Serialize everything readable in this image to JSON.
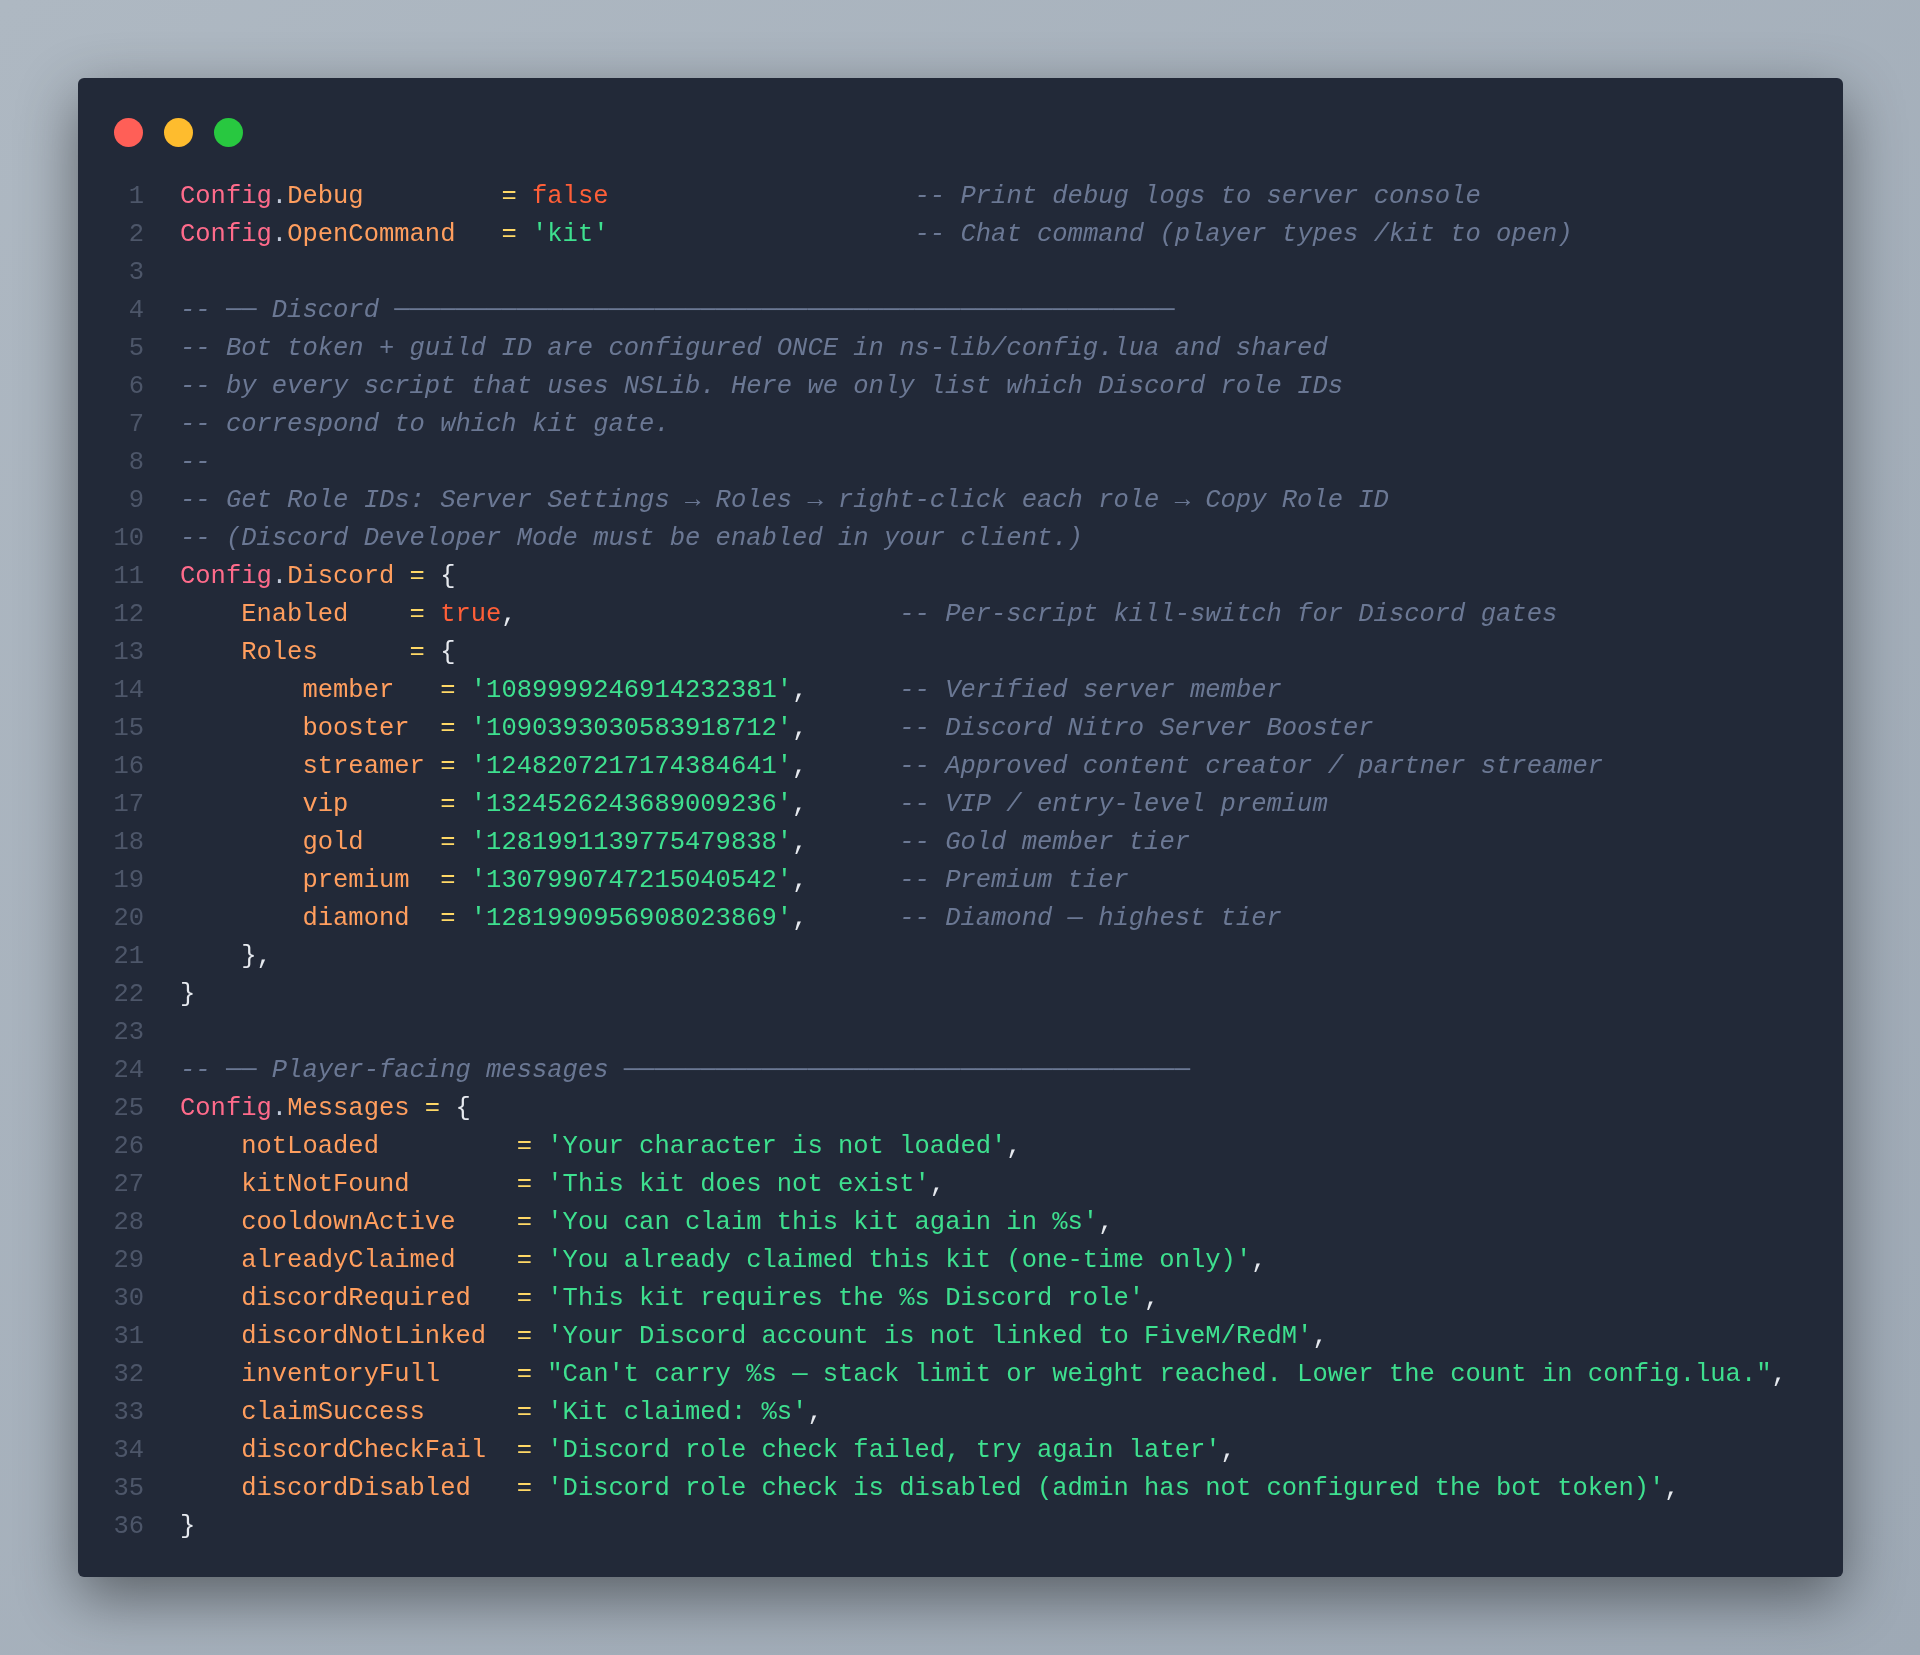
{
  "window_controls": [
    {
      "color": "#ff5f57"
    },
    {
      "color": "#febc2e"
    },
    {
      "color": "#28c840"
    }
  ],
  "lines": [
    {
      "number": "1",
      "tokens": [
        {
          "kind": "object",
          "text": "Config"
        },
        {
          "kind": "punct",
          "text": "."
        },
        {
          "kind": "key",
          "text": "Debug"
        },
        {
          "kind": "op",
          "text": "         ="
        },
        {
          "kind": "boolean",
          "text": " false"
        },
        {
          "kind": "comment",
          "text": "                    -- Print debug logs to server console"
        }
      ]
    },
    {
      "number": "2",
      "tokens": [
        {
          "kind": "object",
          "text": "Config"
        },
        {
          "kind": "punct",
          "text": "."
        },
        {
          "kind": "key",
          "text": "OpenCommand"
        },
        {
          "kind": "op",
          "text": "   ="
        },
        {
          "kind": "string",
          "text": " 'kit'"
        },
        {
          "kind": "comment",
          "text": "                    -- Chat command (player types /kit to open)"
        }
      ]
    },
    {
      "number": "3"
    },
    {
      "number": "4",
      "tokens": [
        {
          "kind": "comment",
          "text": "-- ── Discord ───────────────────────────────────────────────────"
        }
      ]
    },
    {
      "number": "5",
      "tokens": [
        {
          "kind": "comment",
          "text": "-- Bot token + guild ID are configured ONCE in ns-lib/config.lua and shared"
        }
      ]
    },
    {
      "number": "6",
      "tokens": [
        {
          "kind": "comment",
          "text": "-- by every script that uses NSLib. Here we only list which Discord role IDs"
        }
      ]
    },
    {
      "number": "7",
      "tokens": [
        {
          "kind": "comment",
          "text": "-- correspond to which kit gate."
        }
      ]
    },
    {
      "number": "8",
      "tokens": [
        {
          "kind": "comment",
          "text": "--"
        }
      ]
    },
    {
      "number": "9",
      "tokens": [
        {
          "kind": "comment",
          "text": "-- Get Role IDs: Server Settings → Roles → right-click each role → Copy Role ID"
        }
      ]
    },
    {
      "number": "10",
      "tokens": [
        {
          "kind": "comment",
          "text": "-- (Discord Developer Mode must be enabled in your client.)"
        }
      ]
    },
    {
      "number": "11",
      "tokens": [
        {
          "kind": "object",
          "text": "Config"
        },
        {
          "kind": "punct",
          "text": "."
        },
        {
          "kind": "key",
          "text": "Discord"
        },
        {
          "kind": "op",
          "text": " ="
        },
        {
          "kind": "plain",
          "text": " {"
        }
      ]
    },
    {
      "number": "12",
      "tokens": [
        {
          "kind": "key",
          "text": "    Enabled"
        },
        {
          "kind": "op",
          "text": "    ="
        },
        {
          "kind": "boolean",
          "text": " true"
        },
        {
          "kind": "plain",
          "text": ","
        },
        {
          "kind": "comment",
          "text": "                         -- Per-script kill-switch for Discord gates"
        }
      ]
    },
    {
      "number": "13",
      "tokens": [
        {
          "kind": "key",
          "text": "    Roles"
        },
        {
          "kind": "op",
          "text": "      ="
        },
        {
          "kind": "plain",
          "text": " {"
        }
      ]
    },
    {
      "number": "14",
      "tokens": [
        {
          "kind": "key",
          "text": "        member"
        },
        {
          "kind": "op",
          "text": "   ="
        },
        {
          "kind": "string",
          "text": " '1089999246914232381'"
        },
        {
          "kind": "plain",
          "text": ","
        },
        {
          "kind": "comment",
          "text": "      -- Verified server member"
        }
      ]
    },
    {
      "number": "15",
      "tokens": [
        {
          "kind": "key",
          "text": "        booster"
        },
        {
          "kind": "op",
          "text": "  ="
        },
        {
          "kind": "string",
          "text": " '1090393030583918712'"
        },
        {
          "kind": "plain",
          "text": ","
        },
        {
          "kind": "comment",
          "text": "      -- Discord Nitro Server Booster"
        }
      ]
    },
    {
      "number": "16",
      "tokens": [
        {
          "kind": "key",
          "text": "        streamer"
        },
        {
          "kind": "op",
          "text": " ="
        },
        {
          "kind": "string",
          "text": " '1248207217174384641'"
        },
        {
          "kind": "plain",
          "text": ","
        },
        {
          "kind": "comment",
          "text": "      -- Approved content creator / partner streamer"
        }
      ]
    },
    {
      "number": "17",
      "tokens": [
        {
          "kind": "key",
          "text": "        vip"
        },
        {
          "kind": "op",
          "text": "      ="
        },
        {
          "kind": "string",
          "text": " '1324526243689009236'"
        },
        {
          "kind": "plain",
          "text": ","
        },
        {
          "kind": "comment",
          "text": "      -- VIP / entry-level premium"
        }
      ]
    },
    {
      "number": "18",
      "tokens": [
        {
          "kind": "key",
          "text": "        gold"
        },
        {
          "kind": "op",
          "text": "     ="
        },
        {
          "kind": "string",
          "text": " '1281991139775479838'"
        },
        {
          "kind": "plain",
          "text": ","
        },
        {
          "kind": "comment",
          "text": "      -- Gold member tier"
        }
      ]
    },
    {
      "number": "19",
      "tokens": [
        {
          "kind": "key",
          "text": "        premium"
        },
        {
          "kind": "op",
          "text": "  ="
        },
        {
          "kind": "string",
          "text": " '1307990747215040542'"
        },
        {
          "kind": "plain",
          "text": ","
        },
        {
          "kind": "comment",
          "text": "      -- Premium tier"
        }
      ]
    },
    {
      "number": "20",
      "tokens": [
        {
          "kind": "key",
          "text": "        diamond"
        },
        {
          "kind": "op",
          "text": "  ="
        },
        {
          "kind": "string",
          "text": " '1281990956908023869'"
        },
        {
          "kind": "plain",
          "text": ","
        },
        {
          "kind": "comment",
          "text": "      -- Diamond — highest tier"
        }
      ]
    },
    {
      "number": "21",
      "tokens": [
        {
          "kind": "plain",
          "text": "    },"
        }
      ]
    },
    {
      "number": "22",
      "tokens": [
        {
          "kind": "plain",
          "text": "}"
        }
      ]
    },
    {
      "number": "23"
    },
    {
      "number": "24",
      "tokens": [
        {
          "kind": "comment",
          "text": "-- ── Player-facing messages ─────────────────────────────────────"
        }
      ]
    },
    {
      "number": "25",
      "tokens": [
        {
          "kind": "object",
          "text": "Config"
        },
        {
          "kind": "punct",
          "text": "."
        },
        {
          "kind": "key",
          "text": "Messages"
        },
        {
          "kind": "op",
          "text": " ="
        },
        {
          "kind": "plain",
          "text": " {"
        }
      ]
    },
    {
      "number": "26",
      "tokens": [
        {
          "kind": "key",
          "text": "    notLoaded"
        },
        {
          "kind": "op",
          "text": "         ="
        },
        {
          "kind": "string",
          "text": " 'Your character is not loaded'"
        },
        {
          "kind": "plain",
          "text": ","
        }
      ]
    },
    {
      "number": "27",
      "tokens": [
        {
          "kind": "key",
          "text": "    kitNotFound"
        },
        {
          "kind": "op",
          "text": "       ="
        },
        {
          "kind": "string",
          "text": " 'This kit does not exist'"
        },
        {
          "kind": "plain",
          "text": ","
        }
      ]
    },
    {
      "number": "28",
      "tokens": [
        {
          "kind": "key",
          "text": "    cooldownActive"
        },
        {
          "kind": "op",
          "text": "    ="
        },
        {
          "kind": "string",
          "text": " 'You can claim this kit again in %s'"
        },
        {
          "kind": "plain",
          "text": ","
        }
      ]
    },
    {
      "number": "29",
      "tokens": [
        {
          "kind": "key",
          "text": "    alreadyClaimed"
        },
        {
          "kind": "op",
          "text": "    ="
        },
        {
          "kind": "string",
          "text": " 'You already claimed this kit (one-time only)'"
        },
        {
          "kind": "plain",
          "text": ","
        }
      ]
    },
    {
      "number": "30",
      "tokens": [
        {
          "kind": "key",
          "text": "    discordRequired"
        },
        {
          "kind": "op",
          "text": "   ="
        },
        {
          "kind": "string",
          "text": " 'This kit requires the %s Discord role'"
        },
        {
          "kind": "plain",
          "text": ","
        }
      ]
    },
    {
      "number": "31",
      "tokens": [
        {
          "kind": "key",
          "text": "    discordNotLinked"
        },
        {
          "kind": "op",
          "text": "  ="
        },
        {
          "kind": "string",
          "text": " 'Your Discord account is not linked to FiveM/RedM'"
        },
        {
          "kind": "plain",
          "text": ","
        }
      ]
    },
    {
      "number": "32",
      "tokens": [
        {
          "kind": "key",
          "text": "    inventoryFull"
        },
        {
          "kind": "op",
          "text": "     ="
        },
        {
          "kind": "string",
          "text": " \"Can't carry %s — stack limit or weight reached. Lower the count in config.lua.\""
        },
        {
          "kind": "plain",
          "text": ","
        }
      ]
    },
    {
      "number": "33",
      "tokens": [
        {
          "kind": "key",
          "text": "    claimSuccess"
        },
        {
          "kind": "op",
          "text": "      ="
        },
        {
          "kind": "string",
          "text": " 'Kit claimed: %s'"
        },
        {
          "kind": "plain",
          "text": ","
        }
      ]
    },
    {
      "number": "34",
      "tokens": [
        {
          "kind": "key",
          "text": "    discordCheckFail"
        },
        {
          "kind": "op",
          "text": "  ="
        },
        {
          "kind": "string",
          "text": " 'Discord role check failed, try again later'"
        },
        {
          "kind": "plain",
          "text": ","
        }
      ]
    },
    {
      "number": "35",
      "tokens": [
        {
          "kind": "key",
          "text": "    discordDisabled"
        },
        {
          "kind": "op",
          "text": "   ="
        },
        {
          "kind": "string",
          "text": " 'Discord role check is disabled (admin has not configured the bot token)'"
        },
        {
          "kind": "plain",
          "text": ","
        }
      ]
    },
    {
      "number": "36",
      "tokens": [
        {
          "kind": "plain",
          "text": "}"
        }
      ]
    }
  ]
}
